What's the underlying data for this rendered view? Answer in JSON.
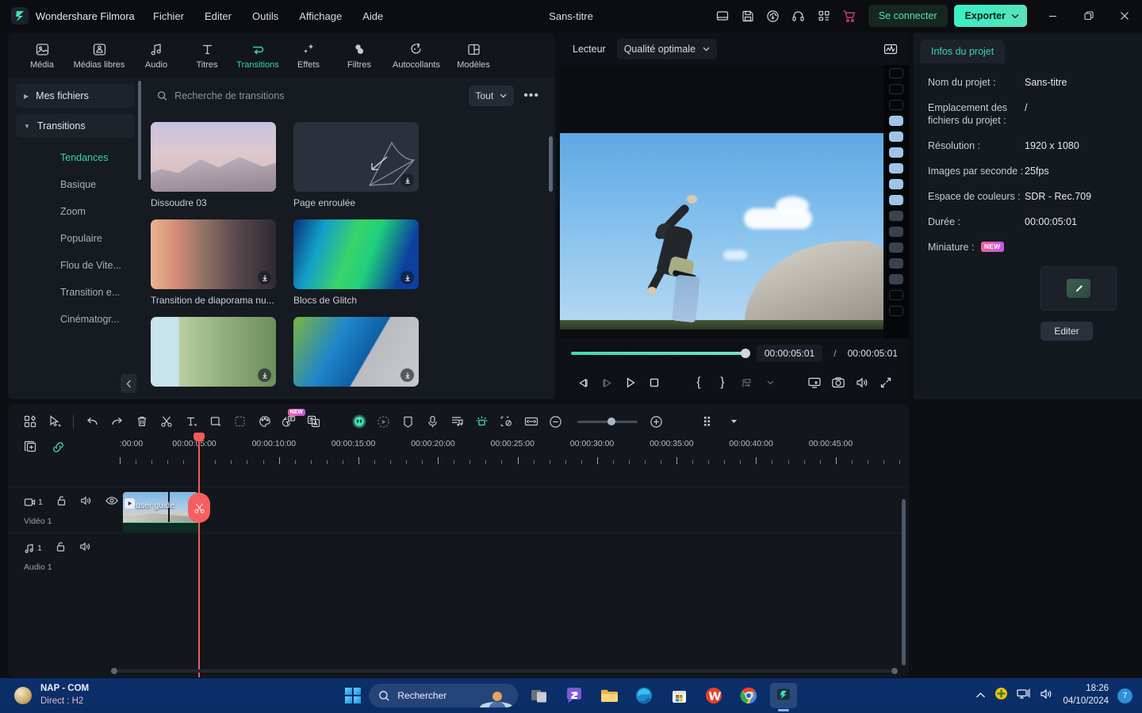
{
  "titlebar": {
    "brand": "Wondershare Filmora",
    "menus": [
      "Fichier",
      "Editer",
      "Outils",
      "Affichage",
      "Aide"
    ],
    "document_title": "Sans-titre",
    "icons": [
      "panel-layout-icon",
      "save-icon",
      "cloud-upload-icon",
      "headset-support-icon",
      "apps-grid-icon",
      "cart-icon"
    ],
    "signin_label": "Se connecter",
    "export_label": "Exporter",
    "window_controls": [
      "minimize",
      "maximize",
      "close"
    ]
  },
  "library": {
    "categories": [
      {
        "label": "Média",
        "icon": "media-icon",
        "active": false
      },
      {
        "label": "Médias libres",
        "icon": "stock-media-icon",
        "active": false
      },
      {
        "label": "Audio",
        "icon": "audio-note-icon",
        "active": false
      },
      {
        "label": "Titres",
        "icon": "title-text-icon",
        "active": false
      },
      {
        "label": "Transitions",
        "icon": "transitions-icon",
        "active": true
      },
      {
        "label": "Effets",
        "icon": "effects-sparkle-icon",
        "active": false
      },
      {
        "label": "Filtres",
        "icon": "filters-icon",
        "active": false
      },
      {
        "label": "Autocollants",
        "icon": "stickers-icon",
        "active": false
      },
      {
        "label": "Modèles",
        "icon": "templates-icon",
        "active": false
      }
    ],
    "sidebar": {
      "groups": [
        {
          "label": "Mes fichiers",
          "expanded": false
        },
        {
          "label": "Transitions",
          "expanded": true
        }
      ],
      "items": [
        {
          "label": "Tendances",
          "active": true
        },
        {
          "label": "Basique",
          "active": false
        },
        {
          "label": "Zoom",
          "active": false
        },
        {
          "label": "Populaire",
          "active": false
        },
        {
          "label": "Flou de Vite...",
          "active": false
        },
        {
          "label": "Transition e...",
          "active": false
        },
        {
          "label": "Cinématogr...",
          "active": false
        }
      ],
      "collapse_icon": "chevron-left-icon"
    },
    "search": {
      "placeholder": "Recherche de transitions",
      "value": "",
      "icon": "search-icon"
    },
    "filter": {
      "label": "Tout",
      "icon": "chevron-down-icon"
    },
    "more_label": "•••",
    "items": [
      {
        "name": "Dissoudre 03",
        "art": "t-dissolve",
        "download": true
      },
      {
        "name": "Page enroulée",
        "art": "t-page",
        "download": true
      },
      {
        "name": "Transition de diaporama nu...",
        "art": "t-slide",
        "download": true
      },
      {
        "name": "Blocs de Glitch",
        "art": "t-glitch",
        "download": true
      },
      {
        "name": "",
        "art": "t-house",
        "download": true
      },
      {
        "name": "",
        "art": "t-ball",
        "download": true
      }
    ]
  },
  "player": {
    "label": "Lecteur",
    "quality": "Qualité optimale",
    "scope_icon": "waveform-scope-icon",
    "current_time": "00:00:05:01",
    "separator": "/",
    "total_time": "00:00:05:01",
    "progress_percent": 100,
    "controls": [
      {
        "name": "previous-frame-button",
        "glyph": "◁|"
      },
      {
        "name": "next-frame-button",
        "glyph": "|▷"
      },
      {
        "name": "play-button",
        "glyph": "▷"
      },
      {
        "name": "stop-button",
        "glyph": "□"
      },
      {
        "name": "mark-in-button",
        "glyph": "{"
      },
      {
        "name": "mark-out-button",
        "glyph": "}"
      },
      {
        "name": "markers-button",
        "glyph": "⌶"
      },
      {
        "name": "markers-dropdown",
        "glyph": "⌄"
      },
      {
        "name": "render-preview-button",
        "glyph": "▭"
      },
      {
        "name": "snapshot-button",
        "glyph": "◎"
      },
      {
        "name": "volume-button",
        "glyph": "◁))"
      },
      {
        "name": "fullscreen-button",
        "glyph": "⤢"
      }
    ]
  },
  "project_info": {
    "tab": "Infos du projet",
    "rows": [
      {
        "key": "Nom du projet :",
        "value": "Sans-titre"
      },
      {
        "key": "Emplacement des fichiers du projet :",
        "value": "/"
      },
      {
        "key": "Résolution :",
        "value": "1920 x 1080"
      },
      {
        "key": "Images par seconde :",
        "value": "25fps"
      },
      {
        "key": "Espace de couleurs :",
        "value": "SDR - Rec.709"
      },
      {
        "key": "Durée :",
        "value": "00:00:05:01"
      }
    ],
    "thumbnail_key": "Miniature :",
    "thumbnail_badge": "NEW",
    "edit_button": "Editer"
  },
  "timeline": {
    "toolbar_left": [
      {
        "name": "layout-grid-button",
        "icon": "grid-layout-icon"
      },
      {
        "name": "select-tool-button",
        "icon": "cursor-select-icon"
      },
      {
        "name": "undo-button",
        "icon": "undo-arrow-icon"
      },
      {
        "name": "redo-button",
        "icon": "redo-arrow-icon"
      },
      {
        "name": "delete-button",
        "icon": "trash-icon"
      },
      {
        "name": "split-button",
        "icon": "scissors-icon"
      },
      {
        "name": "add-text-button",
        "icon": "text-t-icon"
      },
      {
        "name": "crop-button",
        "icon": "crop-square-icon"
      },
      {
        "name": "mask-button",
        "icon": "mask-icon"
      },
      {
        "name": "color-button",
        "icon": "color-palette-icon"
      },
      {
        "name": "speech-to-text-button",
        "icon": "speech-to-text-icon",
        "badge": "NEW"
      },
      {
        "name": "translate-button",
        "icon": "translate-icon"
      }
    ],
    "toolbar_right": [
      {
        "name": "ai-avatar-button",
        "icon": "ai-face-icon"
      },
      {
        "name": "motion-tracking-button",
        "icon": "motion-track-icon"
      },
      {
        "name": "marker-button",
        "icon": "marker-shield-icon"
      },
      {
        "name": "record-voiceover-button",
        "icon": "microphone-icon"
      },
      {
        "name": "audio-mixer-button",
        "icon": "audio-mixer-icon"
      },
      {
        "name": "keyframe-button",
        "icon": "keyframe-sun-icon"
      },
      {
        "name": "remove-background-button",
        "icon": "remove-bg-icon"
      },
      {
        "name": "fit-timeline-button",
        "icon": "fit-width-icon"
      },
      {
        "name": "zoom-out-button",
        "icon": "minus-circle-icon"
      },
      {
        "name": "zoom-in-button",
        "icon": "plus-circle-icon"
      },
      {
        "name": "thumbnail-size-button",
        "icon": "dot-grid-icon"
      },
      {
        "name": "thumbnail-size-dropdown",
        "icon": "caret-down-icon"
      }
    ],
    "head_icons": [
      {
        "name": "add-track-button",
        "icon": "add-track-icon"
      },
      {
        "name": "link-clips-button",
        "icon": "link-chain-icon"
      }
    ],
    "ruler_labels": [
      ":00:00",
      "00:00:05:00",
      "00:00:10:00",
      "00:00:15:00",
      "00:00:20:00",
      "00:00:25:00",
      "00:00:30:00",
      "00:00:35:00",
      "00:00:40:00",
      "00:00:45:00"
    ],
    "tracks": [
      {
        "name": "Vidéo 1",
        "index": "1",
        "type": "video",
        "icons": [
          "video-track-icon",
          "lock-icon",
          "mute-icon",
          "eye-icon"
        ]
      },
      {
        "name": "Audio 1",
        "index": "1",
        "type": "audio",
        "icons": [
          "audio-track-icon",
          "lock-icon",
          "mute-icon"
        ]
      }
    ],
    "clip": {
      "name": "user guide",
      "track": "Vidéo 1"
    },
    "playhead_time": "00:00:05:01",
    "split_tooltip_icon": "scissors-icon"
  },
  "taskbar": {
    "station": {
      "line1": "NAP - COM",
      "line2": "Direct : H2"
    },
    "start_label": "start-button",
    "search_placeholder": "Rechercher",
    "apps": [
      {
        "name": "task-view-icon"
      },
      {
        "name": "teams-chat-icon"
      },
      {
        "name": "file-explorer-icon"
      },
      {
        "name": "microsoft-edge-icon"
      },
      {
        "name": "microsoft-store-icon"
      },
      {
        "name": "wps-office-icon"
      },
      {
        "name": "google-chrome-icon"
      },
      {
        "name": "filmora-icon",
        "active": true
      }
    ],
    "tray": [
      "chevron-up-icon",
      "security-icon",
      "network-icon",
      "volume-icon"
    ],
    "time": "18:26",
    "date": "04/10/2024",
    "notification_count": "7"
  }
}
